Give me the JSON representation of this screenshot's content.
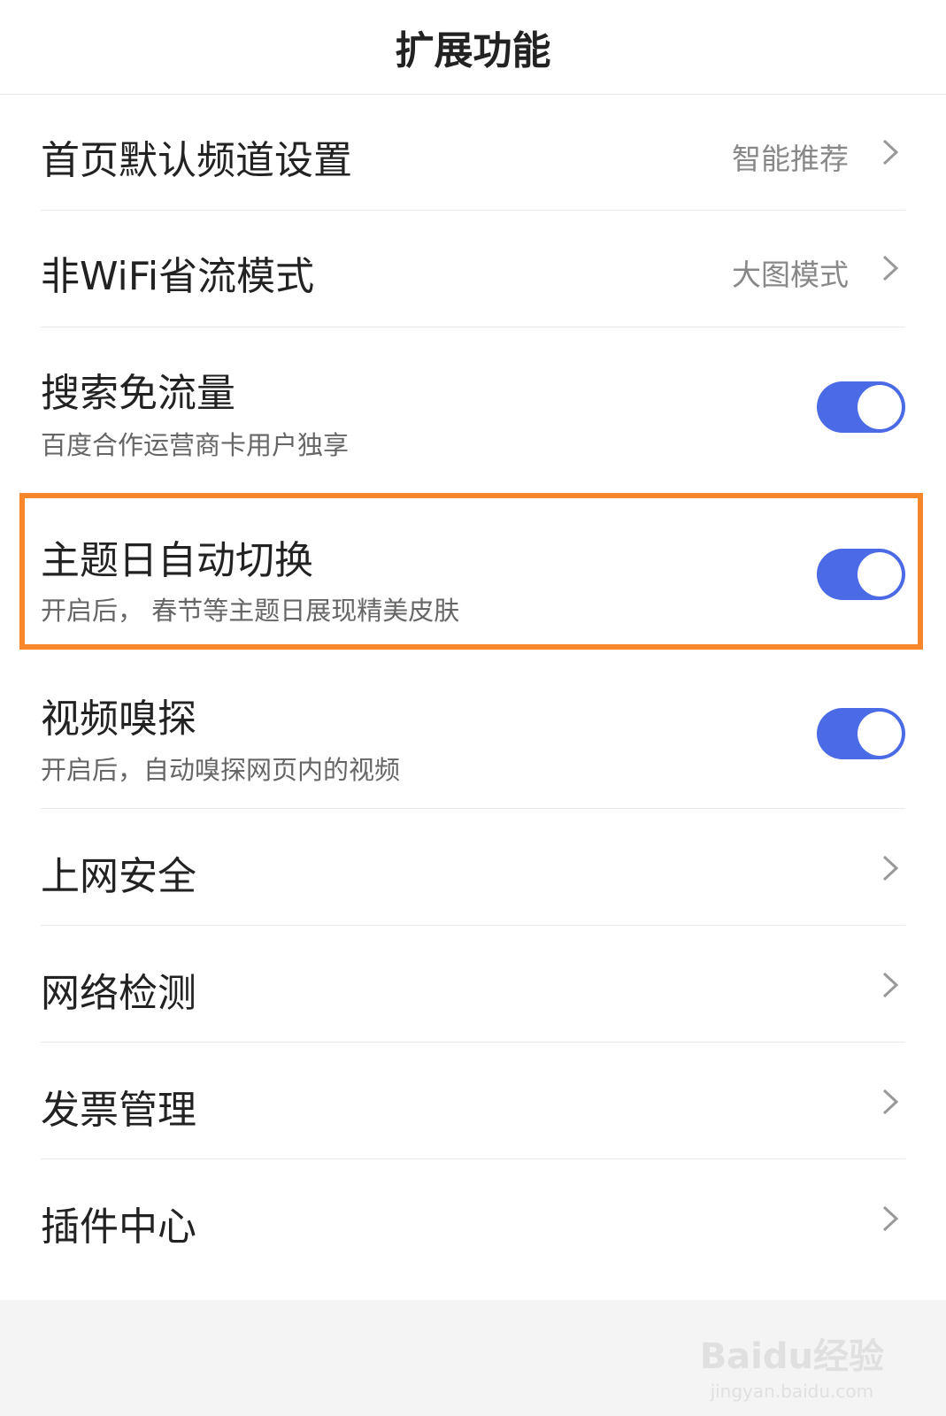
{
  "header": {
    "title": "扩展功能"
  },
  "rows": [
    {
      "title": "首页默认频道设置",
      "value": "智能推荐"
    },
    {
      "title": "非WiFi省流模式",
      "value": "大图模式"
    },
    {
      "title": "搜索免流量",
      "subtitle": "百度合作运营商卡用户独享",
      "toggle": true
    },
    {
      "title": "主题日自动切换",
      "subtitle": "开启后， 春节等主题日展现精美皮肤",
      "toggle": true
    },
    {
      "title": "视频嗅探",
      "subtitle": "开启后，自动嗅探网页内的视频",
      "toggle": true
    },
    {
      "title": "上网安全"
    },
    {
      "title": "网络检测"
    },
    {
      "title": "发票管理"
    },
    {
      "title": "插件中心"
    }
  ],
  "colors": {
    "accent": "#4a6ae6",
    "highlight": "#f7872a"
  },
  "watermark": {
    "brand": "Baidu经验",
    "url": "jingyan.baidu.com"
  }
}
